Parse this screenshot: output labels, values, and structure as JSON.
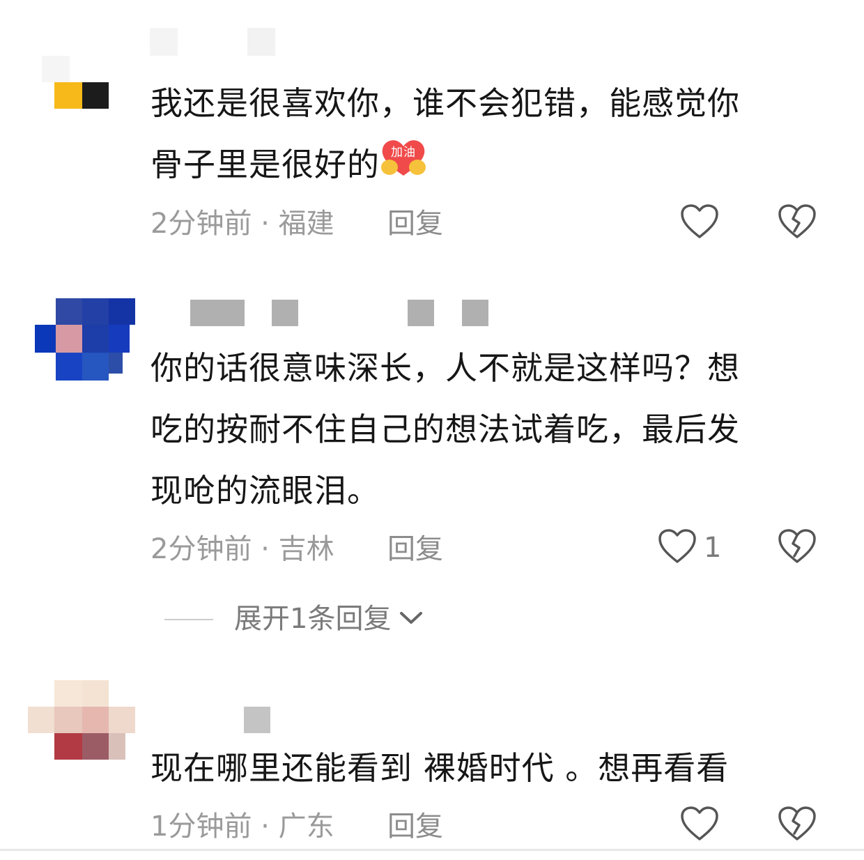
{
  "comments": [
    {
      "text_line1": "我还是很喜欢你，谁不会犯错，能感觉你",
      "text_line2": "骨子里是很好的",
      "emoji": "加油",
      "meta": "2分钟前 · 福建",
      "reply_label": "回复",
      "like_count": ""
    },
    {
      "text_line1": "你的话很意味深长，人不就是这样吗？想",
      "text_line2": "吃的按耐不住自己的想法试着吃，最后发",
      "text_line3": "现呛的流眼泪。",
      "meta": "2分钟前 · 吉林",
      "reply_label": "回复",
      "like_count": "1",
      "expand_label": "展开1条回复"
    },
    {
      "text_line1": "现在哪里还能看到 裸婚时代 。想再看看",
      "meta": "1分钟前 · 广东",
      "reply_label": "回复",
      "like_count": ""
    }
  ],
  "colors": {
    "text": "#161616",
    "meta": "#9a9a9a",
    "icon": "#555555",
    "emoji_heart": "#f04a4a",
    "emoji_hands": "#f6c13b"
  },
  "icons": [
    "heart-outline-icon",
    "broken-heart-icon",
    "chevron-down-icon"
  ]
}
